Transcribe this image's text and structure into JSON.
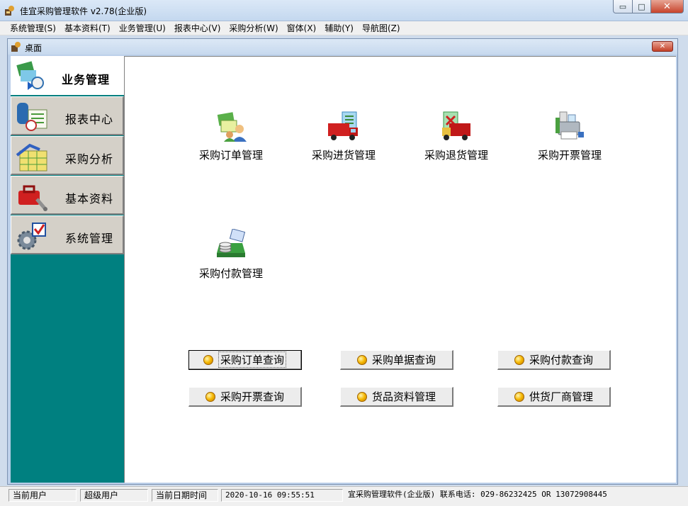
{
  "window": {
    "title": "佳宜采购管理软件 v2.78(企业版)",
    "controls": {
      "minimize": "▭",
      "maximize": "□",
      "close": "✕"
    }
  },
  "menubar": [
    "系统管理(S)",
    "基本资料(T)",
    "业务管理(U)",
    "报表中心(V)",
    "采购分析(W)",
    "窗体(X)",
    "辅助(Y)",
    "导航图(Z)"
  ],
  "child": {
    "title": "桌面",
    "close": "✕"
  },
  "sidebar": {
    "items": [
      {
        "label": "业务管理",
        "icon": "business-icon",
        "active": true
      },
      {
        "label": "报表中心",
        "icon": "report-icon",
        "active": false
      },
      {
        "label": "采购分析",
        "icon": "analysis-icon",
        "active": false
      },
      {
        "label": "基本资料",
        "icon": "toolbox-icon",
        "active": false
      },
      {
        "label": "系统管理",
        "icon": "settings-icon",
        "active": false
      }
    ]
  },
  "main": {
    "tiles": [
      {
        "label": "采购订单管理",
        "icon": "purchase-order-icon"
      },
      {
        "label": "采购进货管理",
        "icon": "truck-inbound-icon"
      },
      {
        "label": "采购退货管理",
        "icon": "truck-return-icon"
      },
      {
        "label": "采购开票管理",
        "icon": "invoice-printer-icon"
      },
      {
        "label": "采购付款管理",
        "icon": "payment-coins-icon"
      }
    ],
    "quick_buttons": [
      {
        "label": "采购订单查询",
        "focused": true
      },
      {
        "label": "采购单据查询",
        "focused": false
      },
      {
        "label": "采购付款查询",
        "focused": false
      },
      {
        "label": "采购开票查询",
        "focused": false
      },
      {
        "label": "货品资料管理",
        "focused": false
      },
      {
        "label": "供货厂商管理",
        "focused": false
      }
    ]
  },
  "statusbar": {
    "user_label": "当前用户",
    "user_value": "超级用户",
    "datetime_label": "当前日期时间",
    "datetime_value": "2020-10-16 09:55:51",
    "info": "宜采购管理软件(企业版)   联系电话: 029-86232425  OR  13072908445"
  },
  "colors": {
    "sidebar_bg": "#008080",
    "accent_dot": "#f5b700",
    "titlebar": "#c4d8ef"
  }
}
